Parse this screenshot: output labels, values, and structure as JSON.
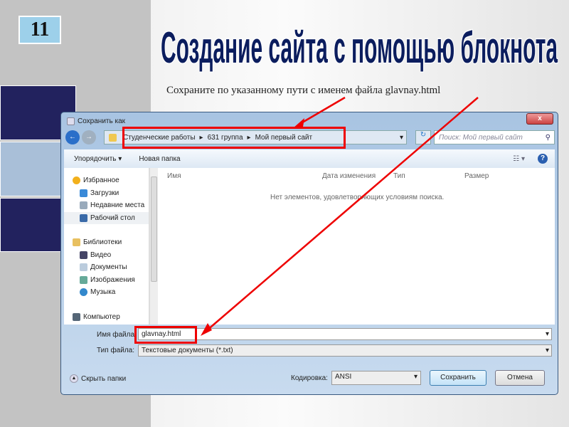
{
  "slide": {
    "number": "11",
    "title": "Создание сайта  с помощью блокнота",
    "subtitle": "Сохраните по указанному пути с именем файла glavnay.html"
  },
  "dialog": {
    "title": "Сохранить как",
    "close": "x",
    "path": [
      "Студенческие работы",
      "631 группа",
      "Мой первый сайт"
    ],
    "search_placeholder": "Поиск: Мой первый сайт",
    "organize": "Упорядочить ▾",
    "new_folder": "Новая папка",
    "nav": [
      {
        "label": "Избранное",
        "color": "#f2b01c"
      },
      {
        "label": "Загрузки",
        "color": "#3a8ad8"
      },
      {
        "label": "Недавние места",
        "color": "#9ab"
      },
      {
        "label": "Рабочий стол",
        "color": "#3a6aa8"
      },
      {
        "label": "Библиотеки",
        "color": "#e8c060"
      },
      {
        "label": "Видео",
        "color": "#446"
      },
      {
        "label": "Документы",
        "color": "#bcd"
      },
      {
        "label": "Изображения",
        "color": "#6a9"
      },
      {
        "label": "Музыка",
        "color": "#38c"
      },
      {
        "label": "Компьютер",
        "color": "#567"
      }
    ],
    "columns": [
      "Имя",
      "Дата изменения",
      "Тип",
      "Размер"
    ],
    "empty": "Нет элементов, удовлетворяющих условиям поиска.",
    "filename_label": "Имя файла:",
    "filename": "glavnay.html",
    "filetype_label": "Тип файла:",
    "filetype": "Текстовые документы (*.txt)",
    "hide_folders": "Скрыть папки",
    "encoding_label": "Кодировка:",
    "encoding": "ANSI",
    "save": "Сохранить",
    "cancel": "Отмена"
  }
}
